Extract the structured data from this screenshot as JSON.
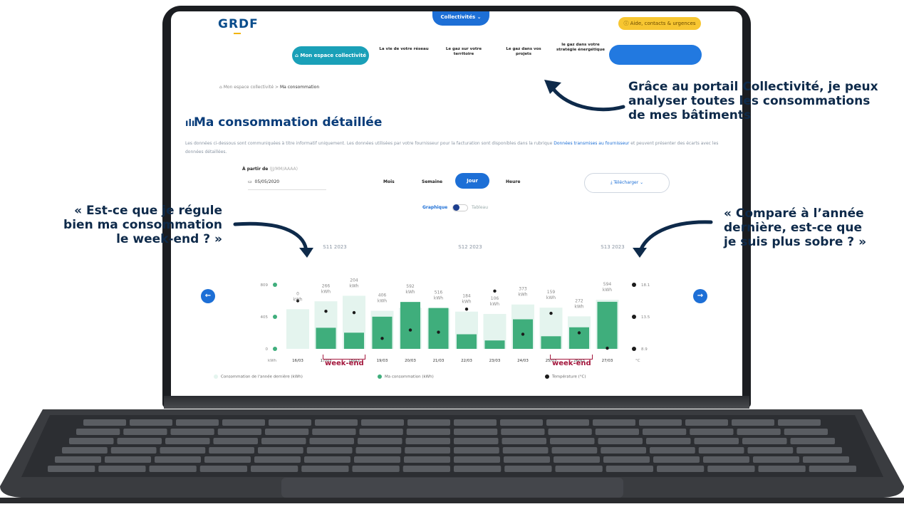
{
  "header": {
    "logo": "GRDF",
    "collectivites_label": "Collectivités ⌄",
    "aide_label": "ⓘ Aide, contacts & urgences"
  },
  "nav": {
    "espace_label": "⌂ Mon espace collectivité",
    "items": [
      "La vie de votre réseau",
      "Le gaz sur votre territoire",
      "Le gaz dans vos projets",
      "le gaz dans votre stratégie énergétique"
    ]
  },
  "breadcrumb": {
    "home": "Mon espace collectivité",
    "sep": ">",
    "current": "Ma consommation"
  },
  "page": {
    "title": "Ma consommation détaillée",
    "description_1": "Les données ci-dessous sont communiquées à titre informatif uniquement. Les données utilisées par votre fournisseur pour la facturation sont disponibles dans la rubrique",
    "description_link": "Données transmises au fournisseur",
    "description_2": "et peuvent présenter des écarts avec les données détaillées."
  },
  "filters": {
    "from_label": "À partir de",
    "date_placeholder": "(JJ/MM/AAAA)",
    "date_value": "05/05/2020",
    "periods": [
      "Mois",
      "Semaine",
      "Jour",
      "Heure"
    ],
    "selected_period": "Jour",
    "download_label": "⤓ Télécharger ⌄",
    "toggle_graph": "Graphique",
    "toggle_table": "Tableau"
  },
  "colors": {
    "primary": "#1d6fd6",
    "bar": "#3fae7c",
    "bar_prev": "#e4f4ee",
    "temp": "#1b1b1b",
    "annotation": "#0e2a4a",
    "weekend": "#a3163c"
  },
  "chart_data": {
    "type": "bar",
    "weeks": [
      "S11 2023",
      "S12 2023",
      "S13 2023"
    ],
    "categories": [
      "16/03",
      "17/03",
      "18/03",
      "19/03",
      "20/03",
      "21/03",
      "22/03",
      "23/03",
      "24/03",
      "25/03",
      "26/03",
      "27/03"
    ],
    "value_labels": [
      "0",
      "266",
      "204",
      "406",
      "592",
      "516",
      "184",
      "106",
      "373",
      "159",
      "272",
      "594"
    ],
    "unit": "kWh",
    "series": [
      {
        "name": "Consommation de l'année dernière (kWh)",
        "values": [
          500,
          600,
          670,
          480,
          520,
          510,
          470,
          440,
          560,
          520,
          410,
          620
        ]
      },
      {
        "name": "Ma consommation (kWh)",
        "values": [
          0,
          266,
          204,
          406,
          592,
          516,
          184,
          106,
          373,
          159,
          272,
          594
        ]
      },
      {
        "name": "Température (°C)",
        "values": [
          15.8,
          14.3,
          14.1,
          10.4,
          11.6,
          11.3,
          14.6,
          17.2,
          11.0,
          14.0,
          11.2,
          9.0
        ]
      }
    ],
    "y_left_ticks": [
      "809",
      "405",
      "0"
    ],
    "y_left_unit": "kWh",
    "y_right_ticks": [
      "18.1",
      "13.5",
      "8.9"
    ],
    "y_right_unit": "°C",
    "ylim": [
      0,
      809
    ],
    "temp_lim": [
      8.9,
      18.1
    ]
  },
  "annotations": {
    "top": [
      "Grâce au portail Collectivité, je peux",
      "analyser toutes les consommations",
      "de mes bâtiments"
    ],
    "left": [
      "« Est-ce que je régule",
      "bien ma consommation",
      "le week-end ? »"
    ],
    "right": [
      "« Comparé à l’année",
      "dernière, est-ce que",
      "je suis plus sobre ? »"
    ],
    "weekend": "week-end"
  }
}
